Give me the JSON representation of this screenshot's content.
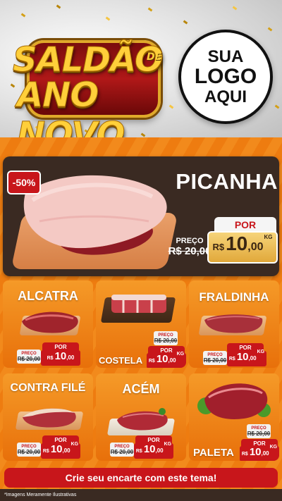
{
  "header": {
    "title_line1": "SALDÃO",
    "title_de": "DE",
    "title_line2": "ANO NOVO",
    "logo": {
      "line1": "SUA",
      "line2": "LOGO",
      "line3": "AQUI"
    }
  },
  "hero": {
    "discount": "-50%",
    "name": "PICANHA",
    "preco_label": "PREÇO",
    "old_price": "R$ 20,00",
    "por_label": "POR",
    "currency": "R$",
    "new_price": "10",
    "cents": ",00",
    "unit": "KG"
  },
  "products": [
    {
      "name": "ALCATRA",
      "preco_label": "PREÇO",
      "old_price": "R$ 20,00",
      "por_label": "POR",
      "currency": "R$",
      "new_price": "10",
      "cents": ",00"
    },
    {
      "name": "COSTELA",
      "preco_label": "PREÇO",
      "old_price": "R$ 20,00",
      "por_label": "POR",
      "currency": "R$",
      "new_price": "10",
      "cents": ",00",
      "unit": "KG"
    },
    {
      "name": "FRALDINHA",
      "preco_label": "PREÇO",
      "old_price": "R$ 20,00",
      "por_label": "POR",
      "currency": "R$",
      "new_price": "10",
      "cents": ",00",
      "unit": "KG"
    },
    {
      "name": "CONTRA FILÉ",
      "preco_label": "PREÇO",
      "old_price": "R$ 20,00",
      "por_label": "POR",
      "currency": "R$",
      "new_price": "10",
      "cents": ",00",
      "unit": "KG"
    },
    {
      "name": "ACÉM",
      "preco_label": "PREÇO",
      "old_price": "R$ 20,00",
      "por_label": "POR",
      "currency": "R$",
      "new_price": "10",
      "cents": ",00",
      "unit": "KG"
    },
    {
      "name": "PALETA",
      "preco_label": "PREÇO",
      "old_price": "R$ 20,00",
      "por_label": "POR",
      "currency": "R$",
      "new_price": "10",
      "cents": ",00",
      "unit": "KG"
    }
  ],
  "footer": {
    "cta": "Crie seu encarte com este tema!",
    "disclaimer": "*Imagens Meramente Ilustrativas"
  },
  "colors": {
    "brand_red": "#c8161b",
    "orange": "#f07a10",
    "dark_brown": "#3a2a22",
    "gold": "#ffcf3a"
  }
}
